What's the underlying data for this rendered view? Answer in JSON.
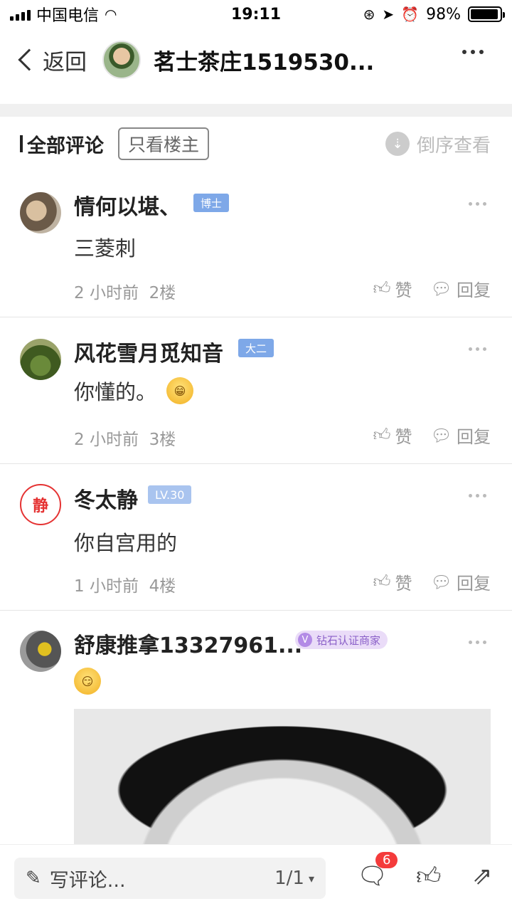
{
  "status": {
    "carrier": "中国电信",
    "time": "19:11",
    "battery": "98%"
  },
  "nav": {
    "back": "返回",
    "title": "茗士茶庄1519530..."
  },
  "filter": {
    "all": "全部评论",
    "only_host": "只看楼主",
    "reverse": "倒序查看"
  },
  "comments": [
    {
      "name": "情何以堪、",
      "badge": "博士",
      "text": "三菱刺",
      "time": "2 小时前",
      "floor": "2楼",
      "like": "赞",
      "reply": "回复"
    },
    {
      "name": "风花雪月觅知音",
      "badge": "大二",
      "text": "你懂的。",
      "time": "2 小时前",
      "floor": "3楼",
      "like": "赞",
      "reply": "回复"
    },
    {
      "name": "冬太静",
      "badge": "LV.30",
      "text": "你自宫用的",
      "time": "1 小时前",
      "floor": "4楼",
      "like": "赞",
      "reply": "回复"
    },
    {
      "name": "舒康推拿13327961...",
      "badge": "钻石认证商家"
    }
  ],
  "bottom": {
    "placeholder": "写评论...",
    "page": "1/1",
    "comment_count": "6"
  },
  "colors": {
    "badge_blue": "#7ea8e8",
    "badge_purple": "#b38be6",
    "count_red": "#f43b3b"
  }
}
